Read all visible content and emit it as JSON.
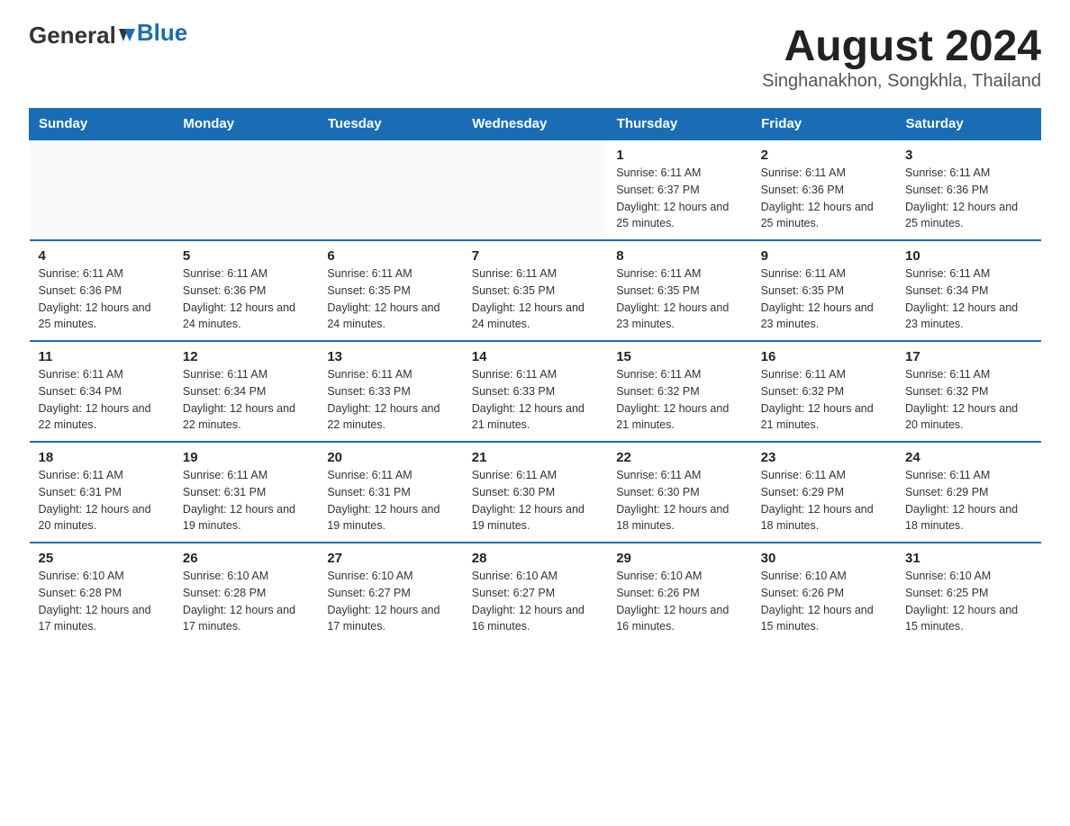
{
  "header": {
    "logo_general": "General",
    "logo_blue": "Blue",
    "title": "August 2024",
    "subtitle": "Singhanakhon, Songkhla, Thailand"
  },
  "days_of_week": [
    "Sunday",
    "Monday",
    "Tuesday",
    "Wednesday",
    "Thursday",
    "Friday",
    "Saturday"
  ],
  "weeks": [
    [
      {
        "day": "",
        "info": ""
      },
      {
        "day": "",
        "info": ""
      },
      {
        "day": "",
        "info": ""
      },
      {
        "day": "",
        "info": ""
      },
      {
        "day": "1",
        "info": "Sunrise: 6:11 AM\nSunset: 6:37 PM\nDaylight: 12 hours and 25 minutes."
      },
      {
        "day": "2",
        "info": "Sunrise: 6:11 AM\nSunset: 6:36 PM\nDaylight: 12 hours and 25 minutes."
      },
      {
        "day": "3",
        "info": "Sunrise: 6:11 AM\nSunset: 6:36 PM\nDaylight: 12 hours and 25 minutes."
      }
    ],
    [
      {
        "day": "4",
        "info": "Sunrise: 6:11 AM\nSunset: 6:36 PM\nDaylight: 12 hours and 25 minutes."
      },
      {
        "day": "5",
        "info": "Sunrise: 6:11 AM\nSunset: 6:36 PM\nDaylight: 12 hours and 24 minutes."
      },
      {
        "day": "6",
        "info": "Sunrise: 6:11 AM\nSunset: 6:35 PM\nDaylight: 12 hours and 24 minutes."
      },
      {
        "day": "7",
        "info": "Sunrise: 6:11 AM\nSunset: 6:35 PM\nDaylight: 12 hours and 24 minutes."
      },
      {
        "day": "8",
        "info": "Sunrise: 6:11 AM\nSunset: 6:35 PM\nDaylight: 12 hours and 23 minutes."
      },
      {
        "day": "9",
        "info": "Sunrise: 6:11 AM\nSunset: 6:35 PM\nDaylight: 12 hours and 23 minutes."
      },
      {
        "day": "10",
        "info": "Sunrise: 6:11 AM\nSunset: 6:34 PM\nDaylight: 12 hours and 23 minutes."
      }
    ],
    [
      {
        "day": "11",
        "info": "Sunrise: 6:11 AM\nSunset: 6:34 PM\nDaylight: 12 hours and 22 minutes."
      },
      {
        "day": "12",
        "info": "Sunrise: 6:11 AM\nSunset: 6:34 PM\nDaylight: 12 hours and 22 minutes."
      },
      {
        "day": "13",
        "info": "Sunrise: 6:11 AM\nSunset: 6:33 PM\nDaylight: 12 hours and 22 minutes."
      },
      {
        "day": "14",
        "info": "Sunrise: 6:11 AM\nSunset: 6:33 PM\nDaylight: 12 hours and 21 minutes."
      },
      {
        "day": "15",
        "info": "Sunrise: 6:11 AM\nSunset: 6:32 PM\nDaylight: 12 hours and 21 minutes."
      },
      {
        "day": "16",
        "info": "Sunrise: 6:11 AM\nSunset: 6:32 PM\nDaylight: 12 hours and 21 minutes."
      },
      {
        "day": "17",
        "info": "Sunrise: 6:11 AM\nSunset: 6:32 PM\nDaylight: 12 hours and 20 minutes."
      }
    ],
    [
      {
        "day": "18",
        "info": "Sunrise: 6:11 AM\nSunset: 6:31 PM\nDaylight: 12 hours and 20 minutes."
      },
      {
        "day": "19",
        "info": "Sunrise: 6:11 AM\nSunset: 6:31 PM\nDaylight: 12 hours and 19 minutes."
      },
      {
        "day": "20",
        "info": "Sunrise: 6:11 AM\nSunset: 6:31 PM\nDaylight: 12 hours and 19 minutes."
      },
      {
        "day": "21",
        "info": "Sunrise: 6:11 AM\nSunset: 6:30 PM\nDaylight: 12 hours and 19 minutes."
      },
      {
        "day": "22",
        "info": "Sunrise: 6:11 AM\nSunset: 6:30 PM\nDaylight: 12 hours and 18 minutes."
      },
      {
        "day": "23",
        "info": "Sunrise: 6:11 AM\nSunset: 6:29 PM\nDaylight: 12 hours and 18 minutes."
      },
      {
        "day": "24",
        "info": "Sunrise: 6:11 AM\nSunset: 6:29 PM\nDaylight: 12 hours and 18 minutes."
      }
    ],
    [
      {
        "day": "25",
        "info": "Sunrise: 6:10 AM\nSunset: 6:28 PM\nDaylight: 12 hours and 17 minutes."
      },
      {
        "day": "26",
        "info": "Sunrise: 6:10 AM\nSunset: 6:28 PM\nDaylight: 12 hours and 17 minutes."
      },
      {
        "day": "27",
        "info": "Sunrise: 6:10 AM\nSunset: 6:27 PM\nDaylight: 12 hours and 17 minutes."
      },
      {
        "day": "28",
        "info": "Sunrise: 6:10 AM\nSunset: 6:27 PM\nDaylight: 12 hours and 16 minutes."
      },
      {
        "day": "29",
        "info": "Sunrise: 6:10 AM\nSunset: 6:26 PM\nDaylight: 12 hours and 16 minutes."
      },
      {
        "day": "30",
        "info": "Sunrise: 6:10 AM\nSunset: 6:26 PM\nDaylight: 12 hours and 15 minutes."
      },
      {
        "day": "31",
        "info": "Sunrise: 6:10 AM\nSunset: 6:25 PM\nDaylight: 12 hours and 15 minutes."
      }
    ]
  ],
  "colors": {
    "header_bg": "#1a6db5",
    "header_text": "#ffffff",
    "border": "#1a6db5"
  }
}
